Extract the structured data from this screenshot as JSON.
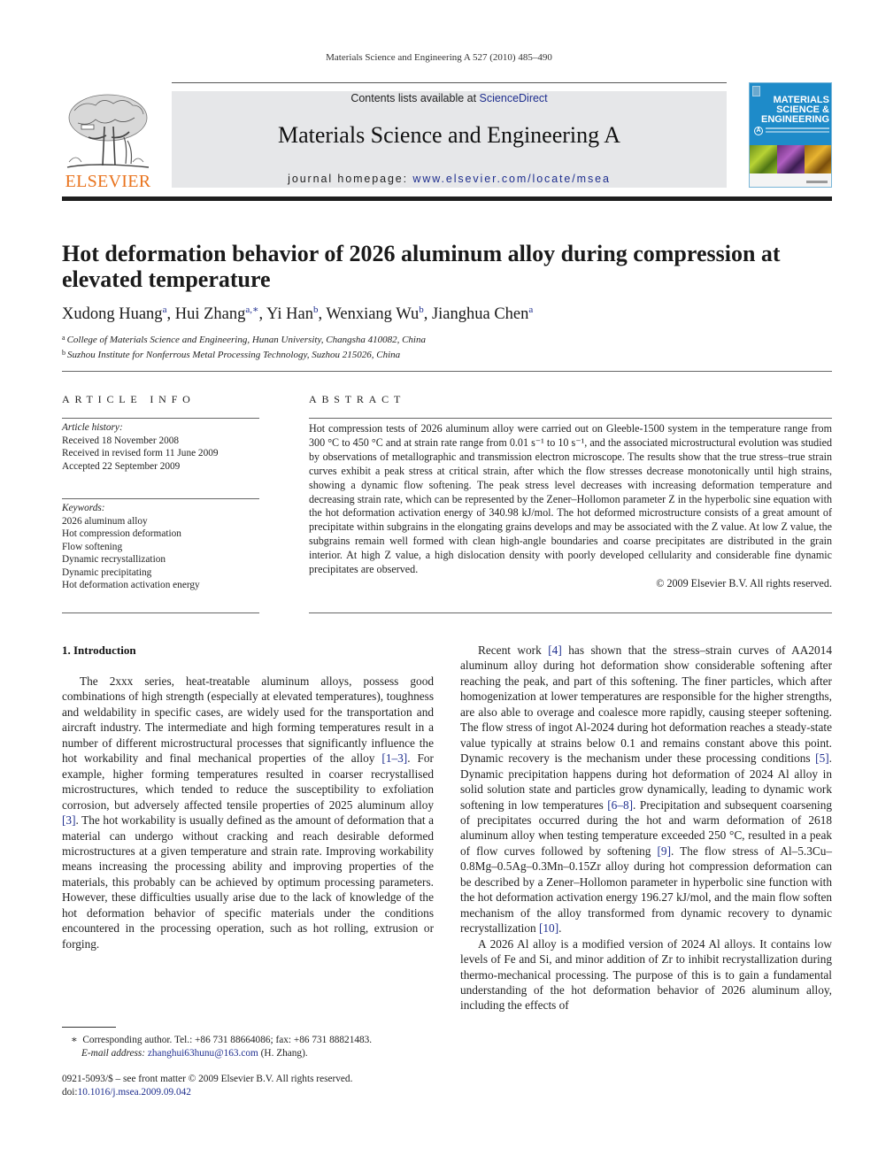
{
  "running_head": "Materials Science and Engineering A 527 (2010) 485–490",
  "publisher": {
    "logo_word": "ELSEVIER",
    "logo_color": "#e9731d"
  },
  "masthead": {
    "contents_prefix": "Contents lists available at ",
    "contents_link": "ScienceDirect",
    "journal_name": "Materials Science and Engineering A",
    "homepage_prefix": "journal homepage: ",
    "homepage_link": "www.elsevier.com/locate/msea",
    "link_color": "#1f2f8f",
    "background": "#e6e7e9"
  },
  "cover": {
    "title_lines": [
      "MATERIALS",
      "SCIENCE &",
      "ENGINEERING"
    ],
    "series_letter": "A",
    "color": "#1e8bc9"
  },
  "article": {
    "title": "Hot deformation behavior of 2026 aluminum alloy during compression at elevated temperature",
    "authors": [
      {
        "name": "Xudong Huang",
        "mark": "a"
      },
      {
        "name": "Hui Zhang",
        "mark": "a,∗"
      },
      {
        "name": "Yi Han",
        "mark": "b"
      },
      {
        "name": "Wenxiang Wu",
        "mark": "b"
      },
      {
        "name": "Jianghua Chen",
        "mark": "a"
      }
    ],
    "affiliations": [
      {
        "mark": "a",
        "text": "College of Materials Science and Engineering, Hunan University, Changsha 410082, China"
      },
      {
        "mark": "b",
        "text": "Suzhou Institute for Nonferrous Metal Processing Technology, Suzhou 215026, China"
      }
    ]
  },
  "article_info": {
    "heading": "ARTICLE INFO",
    "history_label": "Article history:",
    "history": [
      "Received 18 November 2008",
      "Received in revised form 11 June 2009",
      "Accepted 22 September 2009"
    ],
    "keywords_label": "Keywords:",
    "keywords": [
      "2026 aluminum alloy",
      "Hot compression deformation",
      "Flow softening",
      "Dynamic recrystallization",
      "Dynamic precipitating",
      "Hot deformation activation energy"
    ]
  },
  "abstract": {
    "heading": "ABSTRACT",
    "text": "Hot compression tests of 2026 aluminum alloy were carried out on Gleeble-1500 system in the temperature range from 300 °C to 450 °C and at strain rate range from 0.01 s⁻¹ to 10 s⁻¹, and the associated microstructural evolution was studied by observations of metallographic and transmission electron microscope. The results show that the true stress–true strain curves exhibit a peak stress at critical strain, after which the flow stresses decrease monotonically until high strains, showing a dynamic flow softening. The peak stress level decreases with increasing deformation temperature and decreasing strain rate, which can be represented by the Zener–Hollomon parameter Z in the hyperbolic sine equation with the hot deformation activation energy of 340.98 kJ/mol. The hot deformed microstructure consists of a great amount of precipitate within subgrains in the elongating grains develops and may be associated with the Z value. At low Z value, the subgrains remain well formed with clean high-angle boundaries and coarse precipitates are distributed in the grain interior. At high Z value, a high dislocation density with poorly developed cellularity and considerable fine dynamic precipitates are observed.",
    "copyright": "© 2009 Elsevier B.V. All rights reserved."
  },
  "introduction": {
    "heading": "1.  Introduction",
    "left_col": [
      {
        "parts": [
          {
            "t": "The 2xxx series, heat-treatable aluminum alloys, possess good combinations of high strength (especially at elevated temperatures), toughness and weldability in specific cases, are widely used for the transportation and aircraft industry. The intermediate and high forming temperatures result in a number of different microstructural processes that significantly influence the hot workability and final mechanical properties of the alloy "
          },
          {
            "ref": "[1–3]"
          },
          {
            "t": ". For example, higher forming temperatures resulted in coarser recrystallised microstructures, which tended to reduce the susceptibility to exfoliation corrosion, but adversely affected tensile properties of 2025 aluminum alloy "
          },
          {
            "ref": "[3]"
          },
          {
            "t": ". The hot workability is usually defined as the amount of deformation that a material can undergo without cracking and reach desirable deformed microstructures at a given temperature and strain rate. Improving workability means increasing the processing ability and improving properties of the materials, this probably can be achieved by optimum processing parameters. However, these difficulties usually arise due to the lack of knowledge of the hot deformation behavior of specific materials under the conditions encountered in the processing operation, such as hot rolling, extrusion or forging."
          }
        ]
      }
    ],
    "right_col": [
      {
        "parts": [
          {
            "t": "Recent work "
          },
          {
            "ref": "[4]"
          },
          {
            "t": " has shown that the stress–strain curves of AA2014 aluminum alloy during hot deformation show considerable softening after reaching the peak, and part of this softening. The finer particles, which after homogenization at lower temperatures are responsible for the higher strengths, are also able to overage and coalesce more rapidly, causing steeper softening. The flow stress of ingot Al-2024 during hot deformation reaches a steady-state value typically at strains below 0.1 and remains constant above this point. Dynamic recovery is the mechanism under these processing conditions "
          },
          {
            "ref": "[5]"
          },
          {
            "t": ". Dynamic precipitation happens during hot deformation of 2024 Al alloy in solid solution state and particles grow dynamically, leading to dynamic work softening in low temperatures "
          },
          {
            "ref": "[6–8]"
          },
          {
            "t": ". Precipitation and subsequent coarsening of precipitates occurred during the hot and warm deformation of 2618 aluminum alloy when testing temperature exceeded 250 °C, resulted in a peak of flow curves followed by softening "
          },
          {
            "ref": "[9]"
          },
          {
            "t": ". The flow stress of Al–5.3Cu–0.8Mg–0.5Ag–0.3Mn–0.15Zr alloy during hot compression deformation can be described by a Zener–Hollomon parameter in hyperbolic sine function with the hot deformation activation energy 196.27 kJ/mol, and the main flow soften mechanism of the alloy transformed from dynamic recovery to dynamic recrystallization "
          },
          {
            "ref": "[10]"
          },
          {
            "t": "."
          }
        ]
      },
      {
        "parts": [
          {
            "t": "A 2026 Al alloy is a modified version of 2024 Al alloys. It contains low levels of Fe and Si, and minor addition of Zr to inhibit recrystallization during thermo-mechanical processing. The purpose of this is to gain a fundamental understanding of the hot deformation behavior of 2026 aluminum alloy, including the effects of"
          }
        ]
      }
    ]
  },
  "footnote": {
    "mark": "∗",
    "corresponding": "Corresponding author. Tel.: +86 731 88664086; fax: +86 731 88821483.",
    "email_label": "E-mail address:",
    "email": "zhanghui63hunu@163.com",
    "email_suffix": " (H. Zhang)."
  },
  "front_matter": {
    "issn_line": "0921-5093/$ – see front matter © 2009 Elsevier B.V. All rights reserved.",
    "doi_label": "doi:",
    "doi": "10.1016/j.msea.2009.09.042"
  }
}
